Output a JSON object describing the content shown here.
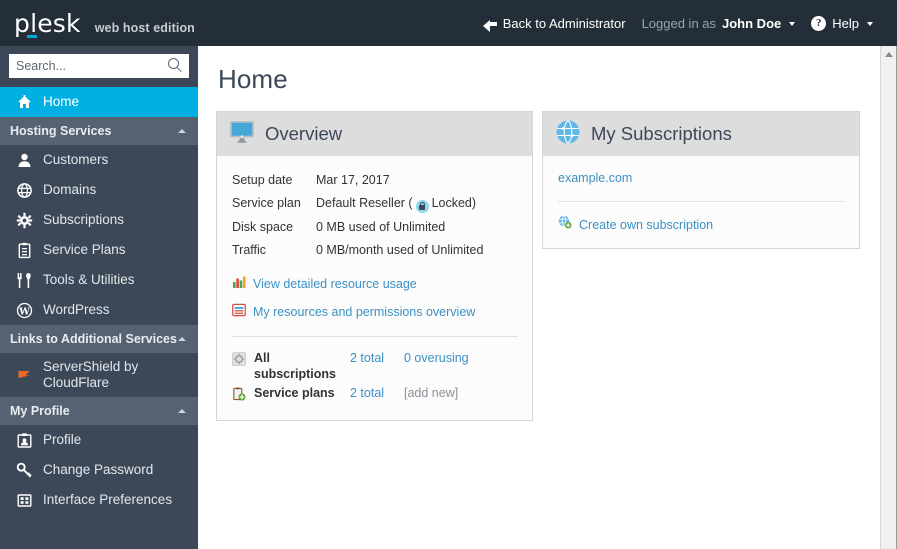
{
  "header": {
    "logo_word": "plesk",
    "logo_edition": "web host edition",
    "back_label": "Back to Administrator",
    "logged_in_prefix": "Logged in as",
    "user_name": "John Doe",
    "help_label": "Help"
  },
  "sidebar": {
    "search_placeholder": "Search...",
    "search_value": "",
    "home_label": "Home",
    "sections": [
      {
        "title": "Hosting Services",
        "items": [
          {
            "label": "Customers",
            "icon": "user-icon"
          },
          {
            "label": "Domains",
            "icon": "globe-icon"
          },
          {
            "label": "Subscriptions",
            "icon": "gear-icon"
          },
          {
            "label": "Service Plans",
            "icon": "clipboard-icon"
          },
          {
            "label": "Tools & Utilities",
            "icon": "tools-icon"
          },
          {
            "label": "WordPress",
            "icon": "wordpress-icon"
          }
        ]
      },
      {
        "title": "Links to Additional Services",
        "items": [
          {
            "label": "ServerShield by CloudFlare",
            "icon": "flag-icon"
          }
        ]
      },
      {
        "title": "My Profile",
        "items": [
          {
            "label": "Profile",
            "icon": "profile-card-icon"
          },
          {
            "label": "Change Password",
            "icon": "key-icon"
          },
          {
            "label": "Interface Preferences",
            "icon": "grid-icon"
          }
        ]
      }
    ]
  },
  "main": {
    "page_title": "Home",
    "overview": {
      "title": "Overview",
      "icon": "monitor-icon",
      "rows": [
        {
          "key": "Setup date",
          "value": "Mar 17, 2017"
        },
        {
          "key": "Service plan",
          "value": "Default Reseller (",
          "lock_suffix": "Locked)"
        },
        {
          "key": "Disk space",
          "value": "0 MB used of Unlimited"
        },
        {
          "key": "Traffic",
          "value": "0 MB/month used of Unlimited"
        }
      ],
      "links": [
        {
          "label": "View detailed resource usage",
          "icon": "bar-chart-icon"
        },
        {
          "label": "My resources and permissions overview",
          "icon": "list-panel-icon"
        }
      ],
      "stats": [
        {
          "name": "All subscriptions",
          "icon": "subscriptions-icon",
          "col1": "2 total",
          "col2": "0 overusing"
        },
        {
          "name": "Service plans",
          "icon": "service-plan-add-icon",
          "col1": "2 total",
          "col2": "[add new]"
        }
      ]
    },
    "subscriptions": {
      "title": "My Subscriptions",
      "icon": "globe-blue-icon",
      "domain": "example.com",
      "create_label": "Create own subscription",
      "create_icon": "globe-add-icon"
    }
  },
  "colors": {
    "topbar": "#242e39",
    "sidebar": "#3c4858",
    "sidebar_section": "#566172",
    "accent_cyan": "#00b0e3",
    "link_blue": "#3b90c4",
    "panel_head": "#dddddd"
  }
}
